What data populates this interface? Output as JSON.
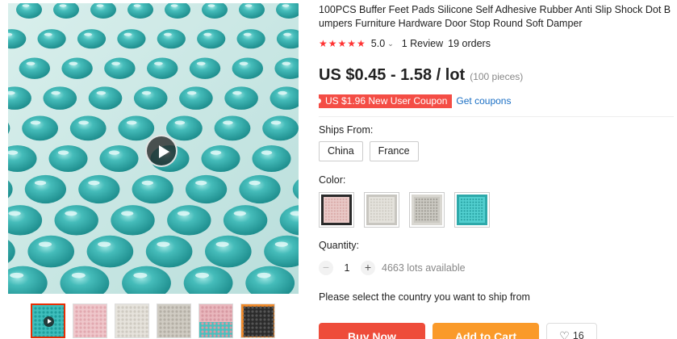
{
  "product": {
    "title": "100PCS Buffer Feet Pads Silicone Self Adhesive Rubber Anti Slip Shock Dot Bumpers Furniture Hardware Door Stop Round Soft Damper",
    "rating": {
      "stars": "★★★★★",
      "score": "5.0",
      "chevron": "⌄",
      "reviews": "1 Review",
      "orders": "19 orders"
    },
    "price": "US $0.45 - 1.58 / lot",
    "pieces": "(100 pieces)",
    "coupon": "US $1.96 New User Coupon",
    "get_coupons": "Get coupons"
  },
  "ships_from": {
    "label": "Ships From:",
    "options": [
      "China",
      "France"
    ]
  },
  "color": {
    "label": "Color:",
    "swatches": [
      {
        "name": "pink",
        "color": "#e9c9c7"
      },
      {
        "name": "white",
        "color": "#e4e2dc"
      },
      {
        "name": "grey",
        "color": "#b9b7b0"
      },
      {
        "name": "teal",
        "color": "#40c4c4"
      }
    ]
  },
  "quantity": {
    "label": "Quantity:",
    "minus": "−",
    "value": "1",
    "plus": "+",
    "available": "4663 lots available"
  },
  "ship_note": "Please select the country you want to ship from",
  "actions": {
    "buy_now": "Buy Now",
    "add_to_cart": "Add to Cart",
    "wishlist_icon": "♡",
    "wishlist_count": "16"
  },
  "gallery": {
    "thumbnails": [
      {
        "name": "teal-video",
        "color": "#3fbfbd"
      },
      {
        "name": "pink",
        "color": "#efc7cb"
      },
      {
        "name": "white",
        "color": "#e6e3dc"
      },
      {
        "name": "beige",
        "color": "#d0ccc3"
      },
      {
        "name": "pink-teal",
        "color": "#e9b7bd"
      },
      {
        "name": "black",
        "color": "#2b2b2b"
      }
    ]
  },
  "colors": {
    "accent": "#ee4c3a",
    "cart": "#fa9a2a",
    "star": "#ff3333",
    "link": "#1a6fc4"
  }
}
